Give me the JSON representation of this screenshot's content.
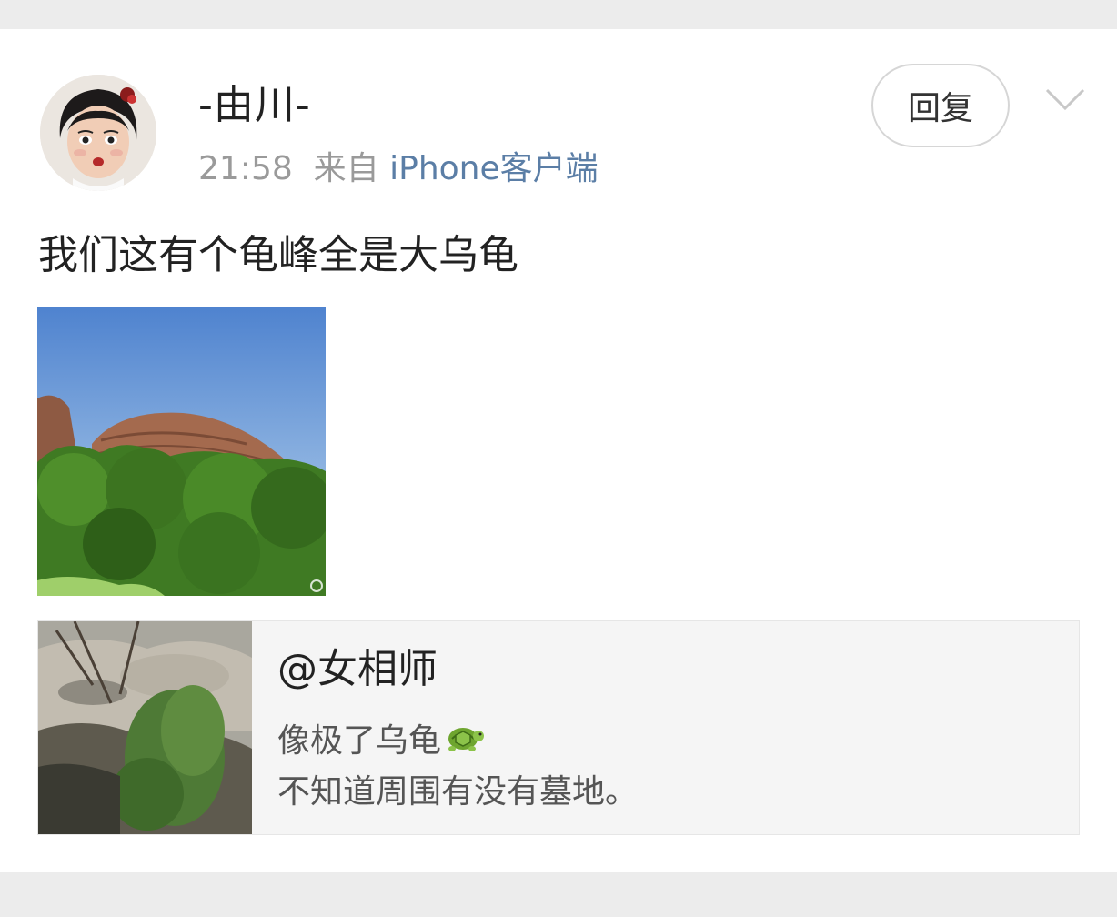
{
  "post": {
    "username": "-由川-",
    "time": "21:58",
    "from_label": "来自",
    "source": "iPhone客户端",
    "reply_label": "回复",
    "text": "我们这有个龟峰全是大乌龟"
  },
  "repost": {
    "author": "@女相师",
    "line1": "像极了乌龟",
    "line2": "不知道周围有没有墓地。"
  },
  "icons": {
    "menu": "chevron-down-icon",
    "emoji": "turtle-emoji-icon",
    "watermark": "weibo-watermark-icon"
  }
}
